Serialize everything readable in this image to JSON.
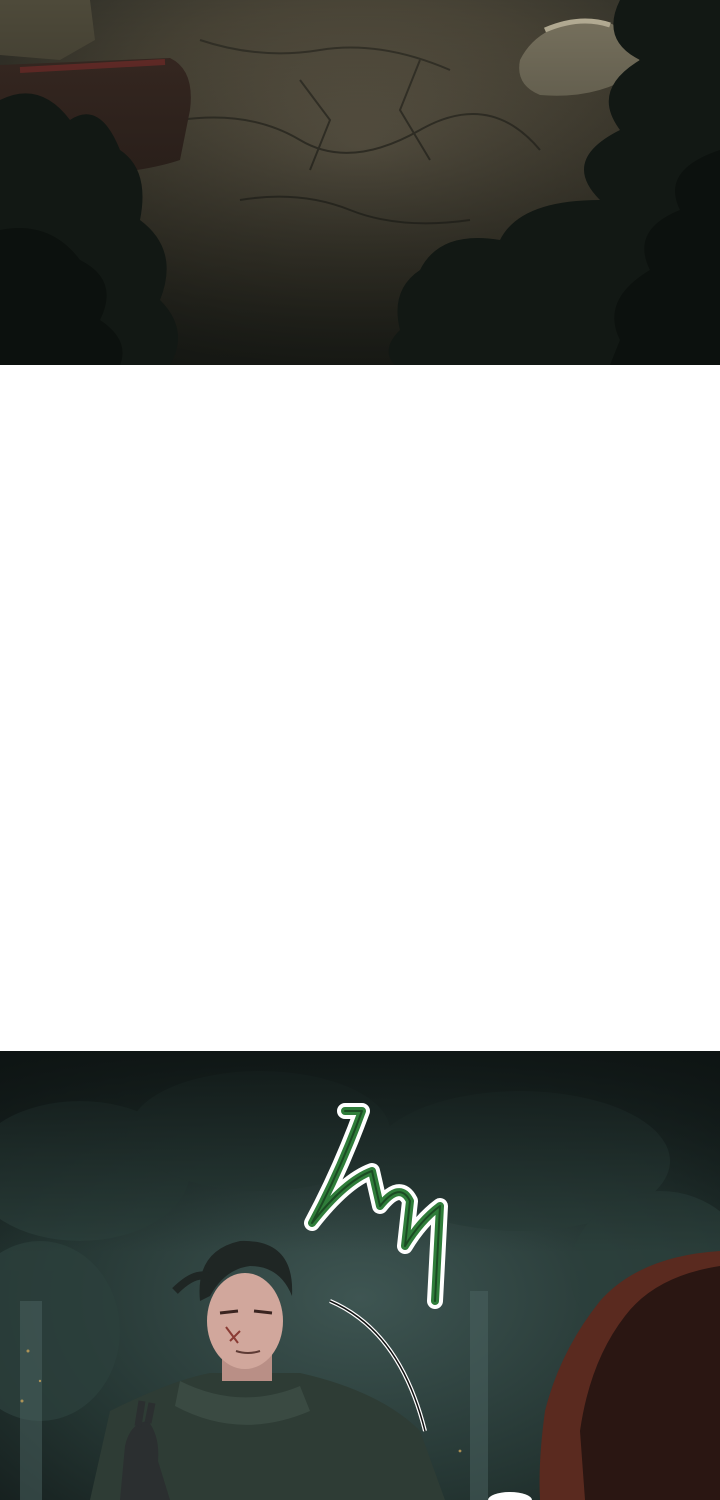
{
  "comic": {
    "panels": [
      {
        "id": "top",
        "description_label": ""
      },
      {
        "id": "bottom",
        "description_label": ""
      }
    ],
    "sfx": {
      "text": ""
    }
  },
  "colors": {
    "panel_top_ground": "#4a4537",
    "panel_top_dark": "#141915",
    "panel_bottom_bg": "#243532",
    "cloak_green": "#2e3c35",
    "sfx_green": "#2f7d3a",
    "hood_red": "#5a2a1f"
  }
}
